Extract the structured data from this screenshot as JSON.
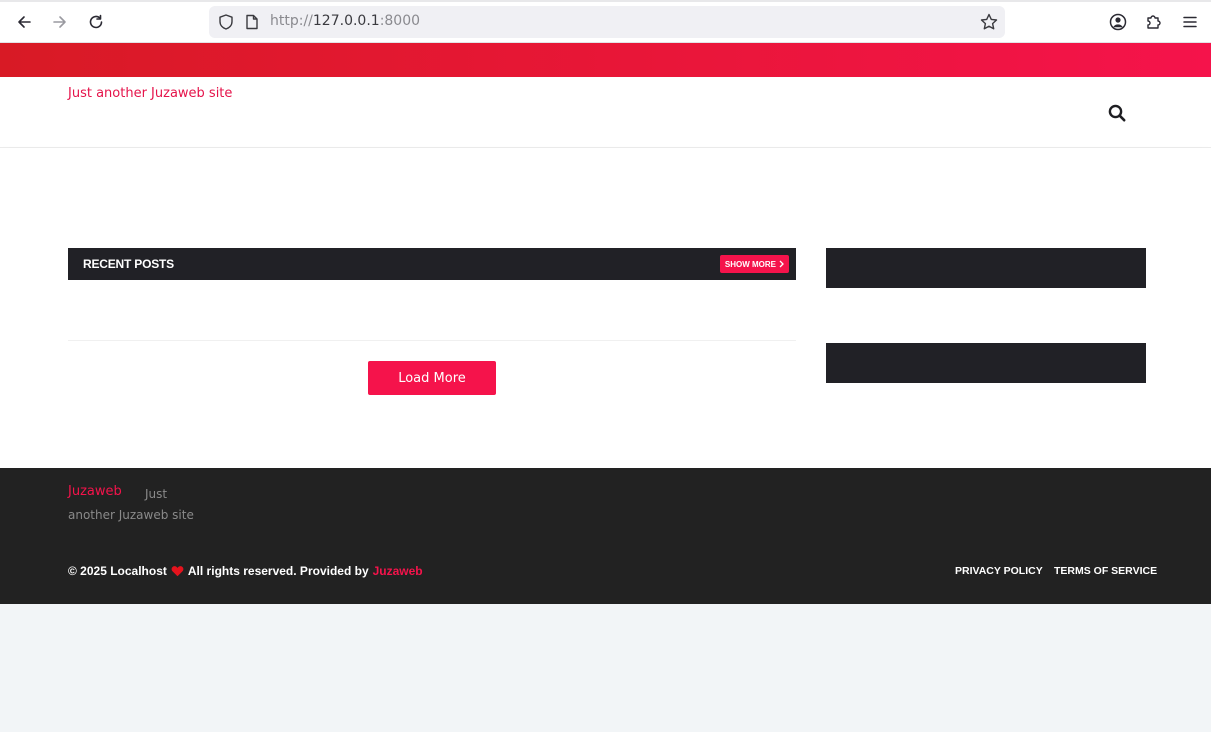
{
  "browser": {
    "url_scheme": "http://",
    "url_host": "127.0.0.1",
    "url_port": ":8000"
  },
  "header": {
    "tagline": "Just another Juzaweb site"
  },
  "main": {
    "recent_posts_title": "RECENT POSTS",
    "show_more_label": "SHOW MORE",
    "load_more_label": "Load More"
  },
  "footer": {
    "brand": "Juzaweb",
    "description_part1": "Just",
    "description_part2": "another Juzaweb site",
    "copyright_prefix": "© 2025 Localhost",
    "copyright_middle": "All rights reserved. Provided by",
    "copyright_link": "Juzaweb",
    "privacy_policy": "PRIVACY POLICY",
    "terms_of_service": "TERMS OF SERVICE"
  },
  "colors": {
    "accent": "#f5134b",
    "dark": "#212126",
    "footer_bg": "#222222"
  }
}
